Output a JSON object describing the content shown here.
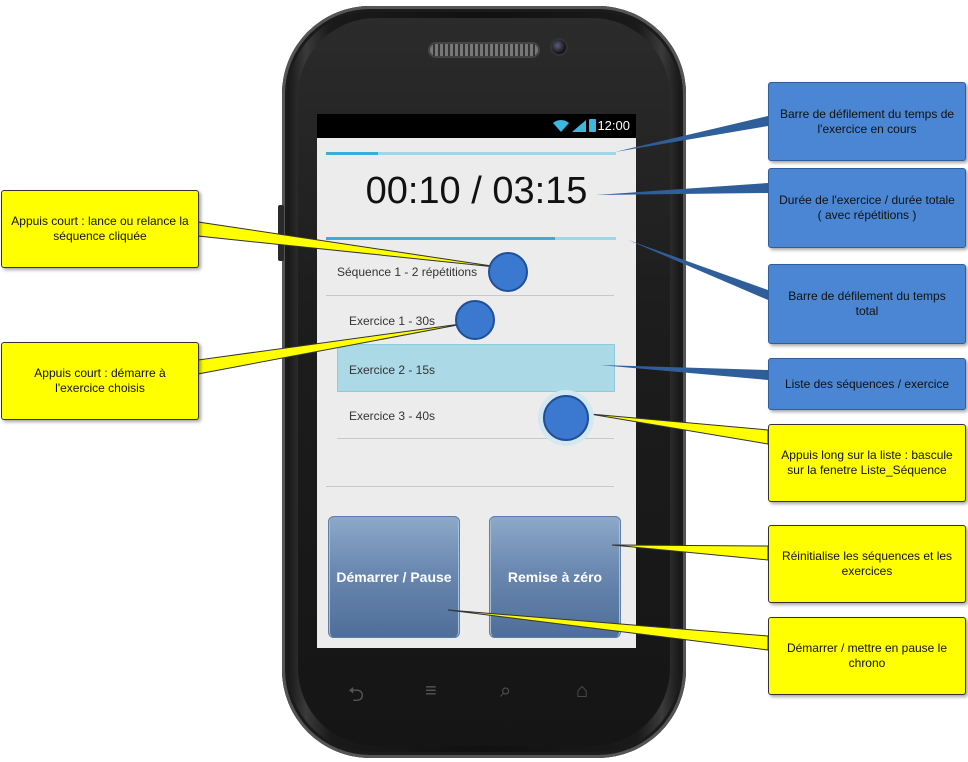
{
  "status": {
    "time": "12:00"
  },
  "progress": {
    "exercise_fraction": 0.18,
    "total_fraction": 0.79
  },
  "timer": {
    "text": "00:10 / 03:15"
  },
  "list": {
    "sequence_label": "Séquence 1 - 2 répétitions",
    "exercises": [
      {
        "label": "Exercice 1 - 30s"
      },
      {
        "label": "Exercice 2 - 15s",
        "selected": true
      },
      {
        "label": "Exercice 3 - 40s"
      }
    ]
  },
  "buttons": {
    "start_pause": "Démarrer / Pause",
    "reset": "Remise à zéro"
  },
  "callouts": {
    "exercise_bar": "Barre de défilement du temps de l'exercice en cours",
    "durations": "Durée de l'exercice / durée totale ( avec répétitions )",
    "total_bar": "Barre de défilement du temps total",
    "list": "Liste des séquences / exercice",
    "long_press": "Appuis long sur la liste : bascule sur la fenetre Liste_Séquence",
    "reset": "Réinitialise les séquences et les exercices",
    "start_pause": "Démarrer / mettre en pause le chrono",
    "short_press_sequence": "Appuis court : lance ou relance la séquence cliquée",
    "short_press_exercise": "Appuis court : démarre à l'exercice choisis"
  },
  "colors": {
    "callout_blue": "#4a86d3",
    "callout_yellow": "#ffff00",
    "accent": "#3aaed8"
  }
}
